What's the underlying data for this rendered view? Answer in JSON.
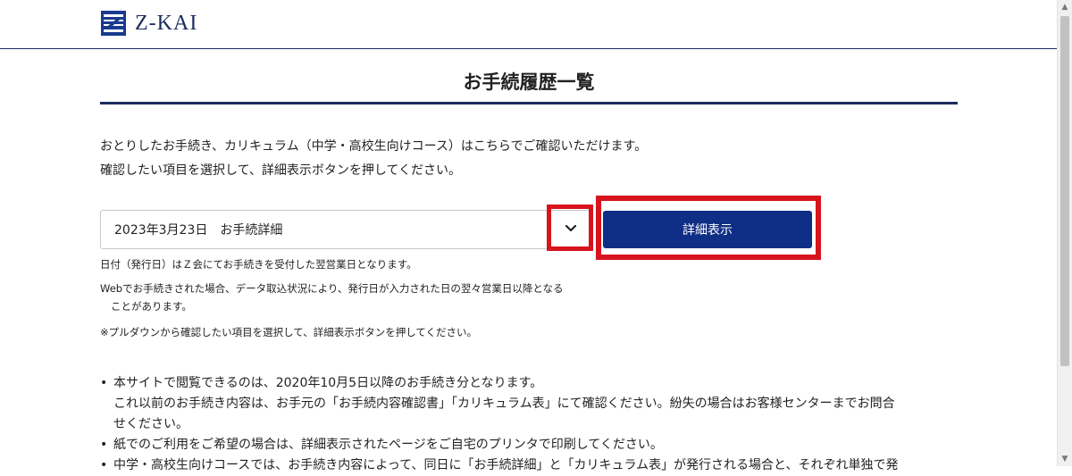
{
  "header": {
    "logo_text": "Z-KAI"
  },
  "page": {
    "title": "お手続履歴一覧"
  },
  "intro": {
    "line1": "おとりしたお手続き、カリキュラム（中学・高校生向けコース）はこちらでご確認いただけます。",
    "line2": "確認したい項目を選択して、詳細表示ボタンを押してください。"
  },
  "select": {
    "value": "2023年3月23日　お手続詳細"
  },
  "detail_button_label": "詳細表示",
  "notes": {
    "n1": "日付（発行日）はＺ会にてお手続きを受付した翌営業日となります。",
    "n2": "Webでお手続きされた場合、データ取込状況により、発行日が入力された日の翌々営業日以降となる",
    "n3": "ことがあります。",
    "n4": "※プルダウンから確認したい項目を選択して、詳細表示ボタンを押してください。"
  },
  "bullets": {
    "b1_line1": "本サイトで閲覧できるのは、2020年10月5日以降のお手続き分となります。",
    "b1_line2": "これ以前のお手続き内容は、お手元の「お手続内容確認書」「カリキュラム表」にて確認ください。紛失の場合はお客様センターまでお問合",
    "b1_line3": "せください。",
    "b2": "紙でのご利用をご希望の場合は、詳細表示されたページをご自宅のプリンタで印刷してください。",
    "b3": "中学・高校生向けコースでは、お手続き内容によって、同日に「お手続詳細」と「カリキュラム表」が発行される場合と、それぞれ単独で発"
  }
}
